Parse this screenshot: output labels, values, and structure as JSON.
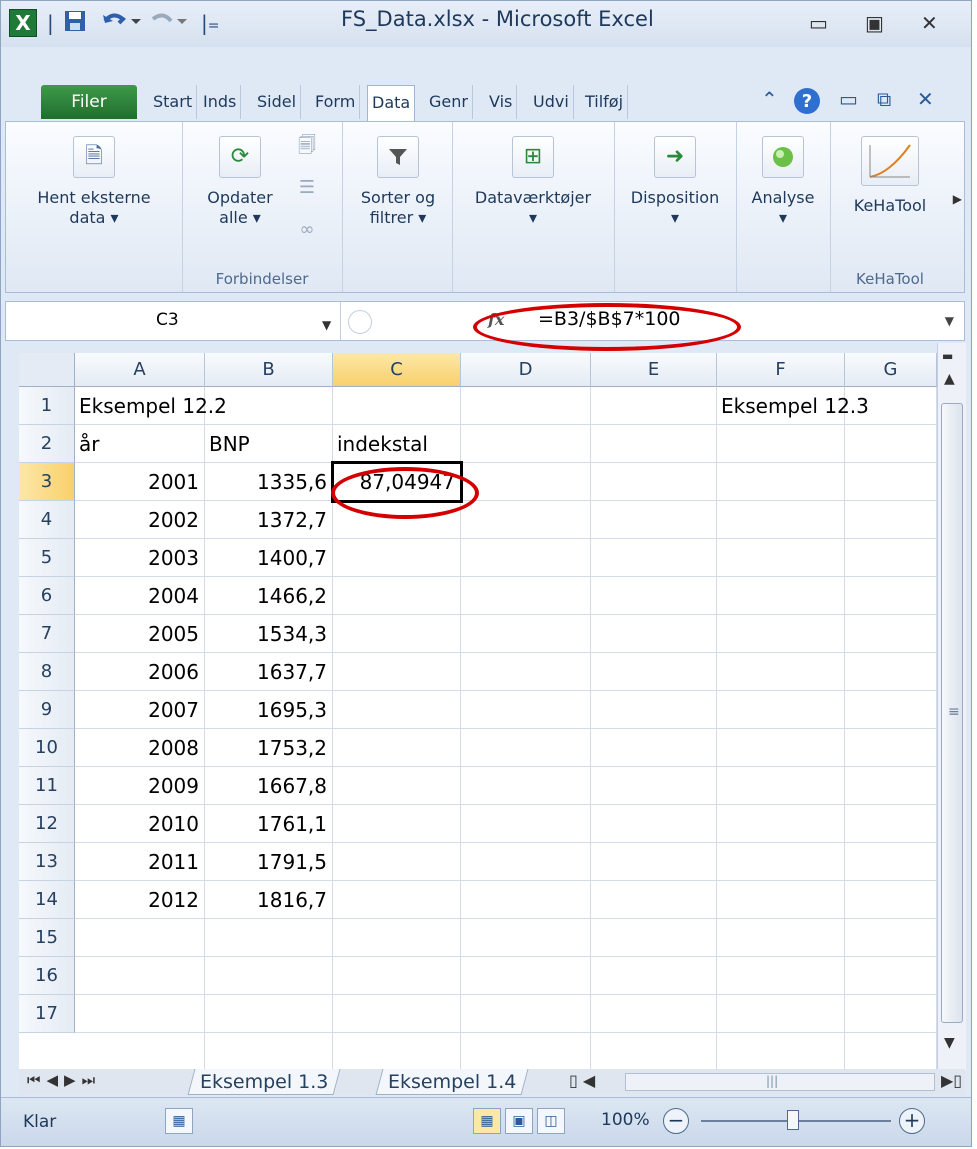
{
  "window": {
    "title": "FS_Data.xlsx - Microsoft Excel",
    "app_icon": "X",
    "qat_save_icon": "save-icon",
    "qat_undo_icon": "undo-icon",
    "qat_redo_icon": "redo-icon"
  },
  "ribbon": {
    "tabs": [
      "Filer",
      "Start",
      "Inds",
      "Sidel",
      "Form",
      "Data",
      "Genr",
      "Vis",
      "Udvi",
      "Tilføj"
    ],
    "active_tab": "Data",
    "groups": {
      "get_external": {
        "label_line1": "Hent eksterne",
        "label_line2": "data ▾"
      },
      "connections": {
        "refresh_line1": "Opdater",
        "refresh_line2": "alle ▾",
        "group_label": "Forbindelser"
      },
      "sort_filter": {
        "label_line1": "Sorter og",
        "label_line2": "filtrer ▾"
      },
      "data_tools": {
        "label_line1": "Dataværktøjer",
        "label_line2": "▾"
      },
      "outline": {
        "label_line1": "Disposition",
        "label_line2": "▾"
      },
      "analysis": {
        "label_line1": "Analyse",
        "label_line2": "▾"
      },
      "kehatool": {
        "button_label": "KeHaTool",
        "group_label": "KeHaTool"
      }
    }
  },
  "formula_bar": {
    "name_box": "C3",
    "fx_label": "fx",
    "formula": "=B3/$B$7*100"
  },
  "grid": {
    "columns": [
      "A",
      "B",
      "C",
      "D",
      "E",
      "F",
      "G"
    ],
    "selected_column": "C",
    "rows": [
      "1",
      "2",
      "3",
      "4",
      "5",
      "6",
      "7",
      "8",
      "9",
      "10",
      "11",
      "12",
      "13",
      "14",
      "15",
      "16",
      "17"
    ],
    "selected_row": "3",
    "cells": {
      "A1": "Eksempel 12.2",
      "F1": "Eksempel 12.3",
      "A2": "år",
      "B2": "BNP",
      "C2": "indekstal",
      "C3": "87,04947"
    },
    "data_rows": [
      {
        "year": "2001",
        "bnp": "1335,6"
      },
      {
        "year": "2002",
        "bnp": "1372,7"
      },
      {
        "year": "2003",
        "bnp": "1400,7"
      },
      {
        "year": "2004",
        "bnp": "1466,2"
      },
      {
        "year": "2005",
        "bnp": "1534,3"
      },
      {
        "year": "2006",
        "bnp": "1637,7"
      },
      {
        "year": "2007",
        "bnp": "1695,3"
      },
      {
        "year": "2008",
        "bnp": "1753,2"
      },
      {
        "year": "2009",
        "bnp": "1667,8"
      },
      {
        "year": "2010",
        "bnp": "1761,1"
      },
      {
        "year": "2011",
        "bnp": "1791,5"
      },
      {
        "year": "2012",
        "bnp": "1816,7"
      }
    ]
  },
  "sheets": [
    "Eksempel 1.3",
    "Eksempel 1.4"
  ],
  "status": {
    "ready": "Klar",
    "zoom": "100%"
  },
  "colors": {
    "highlight_ellipse": "#d40000",
    "file_tab": "#1f6e2c",
    "selected_header": "#f9d06b"
  }
}
